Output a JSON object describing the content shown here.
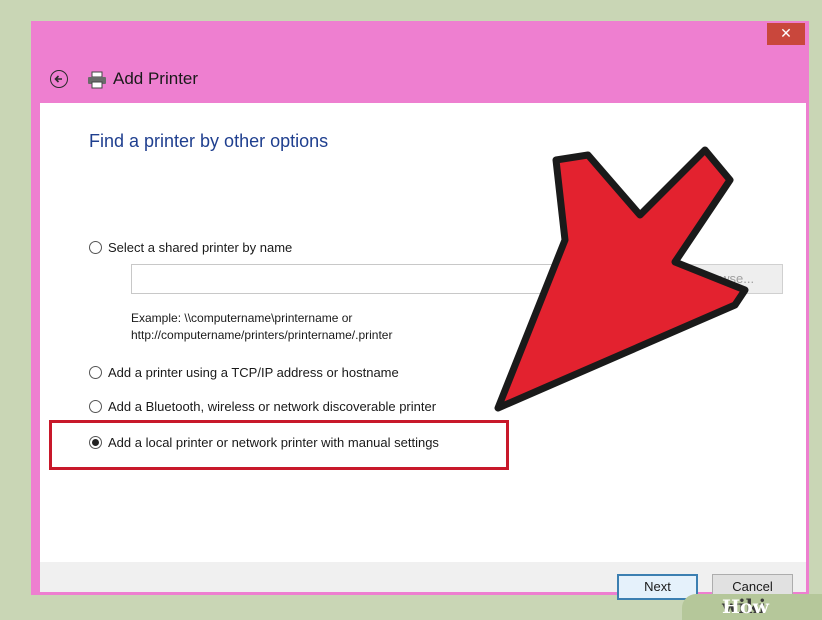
{
  "window": {
    "title": "Add Printer",
    "close_label": "✕"
  },
  "content": {
    "heading": "Find a printer by other options",
    "options": [
      {
        "label": "Select a shared printer by name",
        "checked": false
      },
      {
        "label": "Add a printer using a TCP/IP address or hostname",
        "checked": false
      },
      {
        "label": "Add a Bluetooth, wireless or network discoverable printer",
        "checked": false
      },
      {
        "label": "Add a local printer or network printer with manual settings",
        "checked": true
      }
    ],
    "shared_printer_input": {
      "value": ""
    },
    "browse_label": "Browse...",
    "example_line1": "Example: \\\\computername\\printername or",
    "example_line2": "http://computername/printers/printername/.printer"
  },
  "footer": {
    "next_label": "Next",
    "cancel_label": "Cancel"
  },
  "annotation": {
    "arrow_color": "#e3222f",
    "highlight_color": "#c8182a"
  },
  "watermark": {
    "part1": "wiki",
    "part2": "How"
  },
  "icons": {
    "back": "back-arrow-icon",
    "printer": "printer-icon",
    "close": "close-icon"
  }
}
